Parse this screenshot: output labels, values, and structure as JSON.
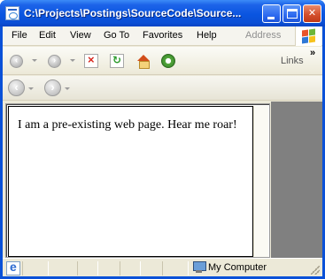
{
  "window": {
    "title": "C:\\Projects\\Postings\\SourceCode\\Source..."
  },
  "menubar": {
    "items": [
      {
        "label": "File"
      },
      {
        "label": "Edit"
      },
      {
        "label": "View"
      },
      {
        "label": "Go To"
      },
      {
        "label": "Favorites"
      },
      {
        "label": "Help"
      }
    ],
    "address_label": "Address"
  },
  "toolbar": {
    "links_label": "Links",
    "chevron": "»"
  },
  "page": {
    "text": "I am a pre-existing web page. Hear me roar!"
  },
  "statusbar": {
    "zone_text": "My Computer"
  },
  "colors": {
    "title_bar": "#0a55e0",
    "close_button": "#d4502c",
    "frame_gray": "#808080"
  }
}
